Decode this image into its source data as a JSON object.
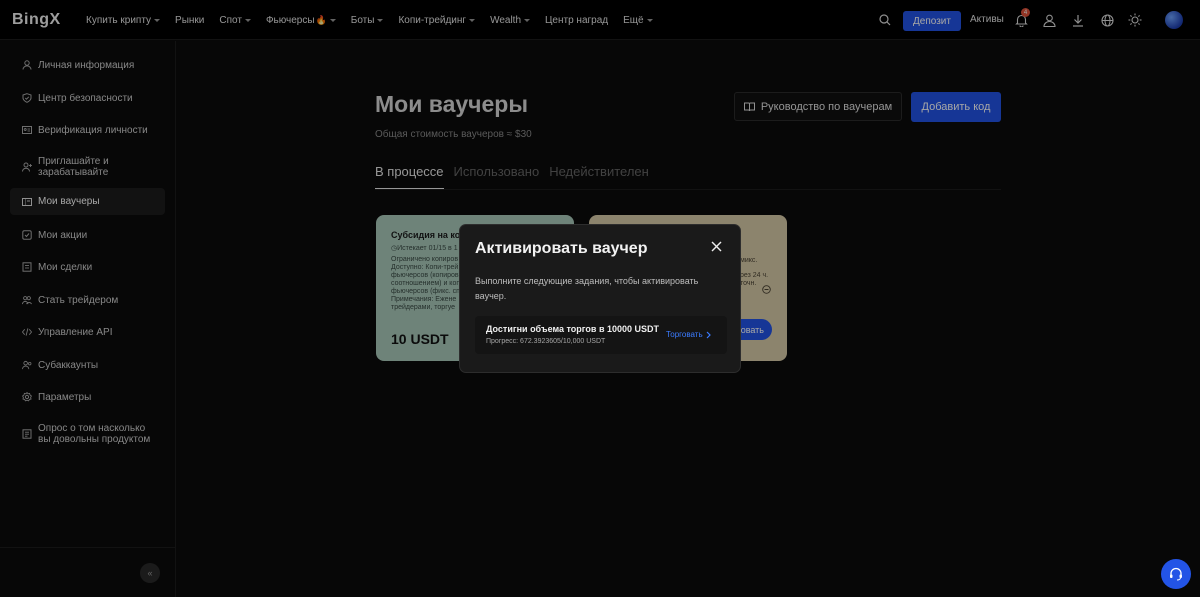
{
  "header": {
    "logo": "BingX",
    "nav": [
      {
        "label": "Купить крипту",
        "caret": true
      },
      {
        "label": "Рынки",
        "caret": false
      },
      {
        "label": "Спот",
        "caret": true
      },
      {
        "label": "Фьючерсы",
        "caret": true,
        "fire": true
      },
      {
        "label": "Боты",
        "caret": true
      },
      {
        "label": "Копи-трейдинг",
        "caret": true
      },
      {
        "label": "Wealth",
        "caret": true
      },
      {
        "label": "Центр наград",
        "caret": false
      },
      {
        "label": "Ещё",
        "caret": true
      }
    ],
    "deposit_label": "Депозит",
    "assets_label": "Активы",
    "notification_count": "4",
    "icons": [
      "search-icon",
      "bell-icon",
      "user-icon",
      "download-icon",
      "globe-icon",
      "sun-icon"
    ]
  },
  "sidebar": {
    "items": [
      {
        "label": "Личная информация",
        "icon": "user-icon"
      },
      {
        "label": "Центр безопасности",
        "icon": "shield-icon"
      },
      {
        "label": "Верификация личности",
        "icon": "id-card-icon"
      },
      {
        "label": "Приглашайте и зарабатывайте",
        "icon": "user-plus-icon"
      },
      {
        "label": "Мои ваучеры",
        "icon": "voucher-icon",
        "active": true
      },
      {
        "label": "Мои акции",
        "icon": "badge-icon"
      },
      {
        "label": "Мои сделки",
        "icon": "document-icon"
      },
      {
        "label": "Стать трейдером",
        "icon": "users-icon"
      },
      {
        "label": "Управление API",
        "icon": "code-icon"
      },
      {
        "label": "Субаккаунты",
        "icon": "sub-account-icon"
      },
      {
        "label": "Параметры",
        "icon": "settings-icon"
      },
      {
        "label": "Опрос о том насколько вы довольны продуктом",
        "icon": "survey-icon"
      }
    ],
    "collapse_label": "«"
  },
  "main": {
    "title": "Мои ваучеры",
    "subtitle": "Общая стоимость ваучеров ≈ $30",
    "guide_label": "Руководство по ваучерам",
    "add_code_label": "Добавить код",
    "tabs": [
      {
        "label": "В процессе",
        "active": true
      },
      {
        "label": "Использовано",
        "active": false
      },
      {
        "label": "Недействителен",
        "active": false
      }
    ],
    "cards": [
      {
        "title": "Субсидия на ко",
        "expires": "◷Истекает 01/15 в 1",
        "lines": [
          "Ограничено копиров",
          "Доступно: Копи-трей",
          "фьючерсов (копиров",
          "соотношением) и копи",
          "фьючерсов (фикс. сп",
          "Примечания: Ежене",
          "трейдерами, торгуе"
        ],
        "amount": "10 USDT",
        "color": "#a9c9bb"
      },
      {
        "lines_right": [
          "микс.",
          "рез 24 ч.",
          "точн."
        ],
        "button_label": "ровать",
        "color": "#d8cba8"
      }
    ]
  },
  "modal": {
    "title": "Активировать ваучер",
    "description": "Выполните следующие задания, чтобы активировать ваучер.",
    "task": {
      "title": "Достигни объема торгов в 10000 USDT",
      "progress": "Прогресс: 672.3923605/10,000 USDT",
      "link_label": "Торговать"
    }
  },
  "colors": {
    "accent": "#2354e6",
    "link": "#3b7bff",
    "badge": "#e0523a",
    "background": "#0b0b0b"
  }
}
